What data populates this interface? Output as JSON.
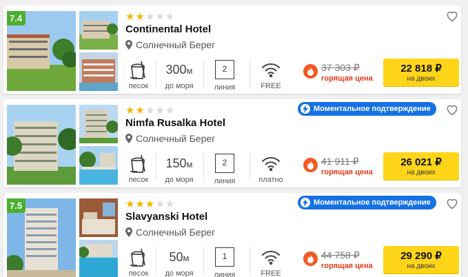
{
  "hotels": [
    {
      "rating": "7.4",
      "stars_filled": 2,
      "stars_total": 5,
      "name": "Continental Hotel",
      "location": "Солнечный Берег",
      "beach_label": "песок",
      "distance_value": "300",
      "distance_unit": "м",
      "distance_label": "до моря",
      "line_number": "2",
      "line_label": "линия",
      "wifi_label": "FREE",
      "old_price": "37 303 ₽",
      "hot_label": "горящая цена",
      "price": "22 818 ₽",
      "price_sub": "на двоих",
      "instant_badge": ""
    },
    {
      "rating": "",
      "stars_filled": 2,
      "stars_total": 5,
      "name": "Nimfa Rusalka Hotel",
      "location": "Солнечный Берег",
      "beach_label": "песок",
      "distance_value": "150",
      "distance_unit": "м",
      "distance_label": "до моря",
      "line_number": "2",
      "line_label": "линия",
      "wifi_label": "платно",
      "old_price": "41 911 ₽",
      "hot_label": "горящая цена",
      "price": "26 021 ₽",
      "price_sub": "на двоих",
      "instant_badge": "Моментальное подтверждение"
    },
    {
      "rating": "7.5",
      "stars_filled": 3,
      "stars_total": 5,
      "name": "Slavyanski Hotel",
      "location": "Солнечный Берег",
      "beach_label": "песок",
      "distance_value": "50",
      "distance_unit": "м",
      "distance_label": "до моря",
      "line_number": "1",
      "line_label": "линия",
      "wifi_label": "FREE",
      "old_price": "44 758 ₽",
      "hot_label": "горящая цена",
      "price": "29 290 ₽",
      "price_sub": "на двоих",
      "instant_badge": "Моментальное подтверждение"
    }
  ],
  "colors": {
    "rating_bg": "#4caf2f",
    "star": "#f5b400",
    "price_button": "#ffd51a",
    "hot": "#e43b1a",
    "instant_badge": "#1671e5"
  },
  "icons": [
    "heart-icon",
    "location-pin-icon",
    "sand-bucket-icon",
    "wifi-icon",
    "flame-icon",
    "lightning-icon"
  ]
}
